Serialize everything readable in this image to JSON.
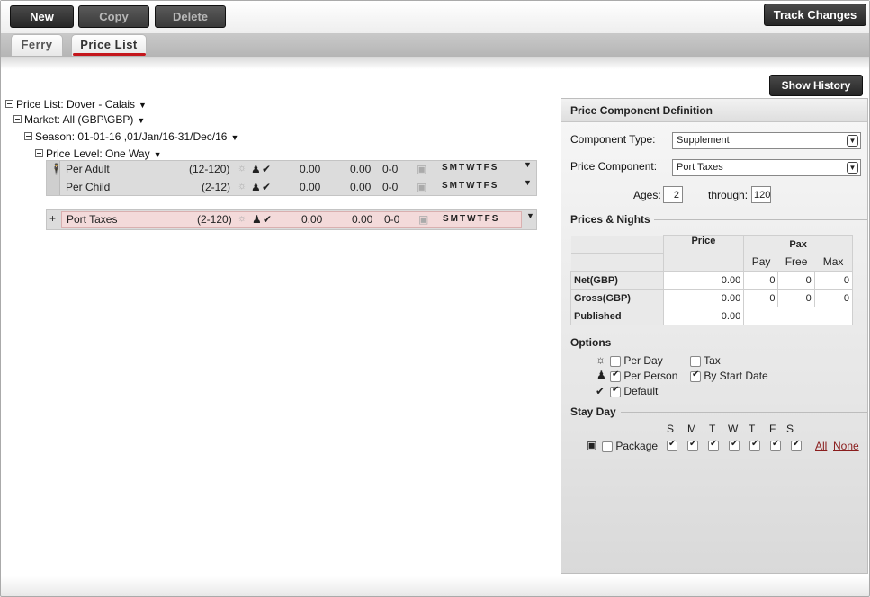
{
  "toolbar": {
    "new_label": "New",
    "copy_label": "Copy",
    "delete_label": "Delete",
    "track_changes_label": "Track Changes"
  },
  "tabs": [
    {
      "label": "Ferry"
    },
    {
      "label": "Price List"
    }
  ],
  "show_history_label": "Show History",
  "tree": {
    "price_list": "Price List: Dover - Calais",
    "market": "Market: All (GBP\\GBP)",
    "season": "Season: 01-01-16 ,01/Jan/16-31/Dec/16",
    "price_level": "Price Level: One Way"
  },
  "grid": {
    "rows": [
      {
        "name": "Per Adult",
        "ages": "(12-120)",
        "price1": "0.00",
        "price2": "0.00",
        "range": "0-0",
        "days": "SMTWTFS"
      },
      {
        "name": "Per Child",
        "ages": "(2-12)",
        "price1": "0.00",
        "price2": "0.00",
        "range": "0-0",
        "days": "SMTWTFS"
      }
    ],
    "selected": {
      "expander": "+",
      "name": "Port Taxes",
      "ages": "(2-120)",
      "price1": "0.00",
      "price2": "0.00",
      "range": "0-0",
      "days": "SMTWTFS"
    }
  },
  "panel": {
    "title": "Price Component Definition",
    "component_type_label": "Component Type:",
    "component_type_value": "Supplement",
    "price_component_label": "Price Component:",
    "price_component_value": "Port Taxes",
    "ages_label": "Ages:",
    "ages_from": "2",
    "through_label": "through:",
    "ages_to": "120",
    "prices_nights_label": "Prices & Nights",
    "price_col": "Price",
    "pax_col": "Pax",
    "pay_col": "Pay",
    "free_col": "Free",
    "max_col": "Max",
    "net_label": "Net(GBP)",
    "net_price": "0.00",
    "net_pay": "0",
    "net_free": "0",
    "net_max": "0",
    "gross_label": "Gross(GBP)",
    "gross_price": "0.00",
    "gross_pay": "0",
    "gross_free": "0",
    "gross_max": "0",
    "published_label": "Published",
    "published_price": "0.00",
    "options_label": "Options",
    "per_day_label": "Per Day",
    "tax_label": "Tax",
    "per_person_label": "Per Person",
    "by_start_date_label": "By Start Date",
    "default_label": "Default",
    "stay_day_label": "Stay Day",
    "day_letters": [
      "S",
      "M",
      "T",
      "W",
      "T",
      "F",
      "S"
    ],
    "package_label": "Package",
    "all_link": "All",
    "none_link": "None"
  },
  "colors": {
    "accent_red": "#c4161c",
    "selected_row_bg": "#f3dada",
    "button_dark": "#2e2e2e"
  },
  "icons": {
    "person": "person-icon",
    "check": "check-icon",
    "sun": "sun-icon",
    "package": "package-icon",
    "caret": "caret-down-icon"
  }
}
